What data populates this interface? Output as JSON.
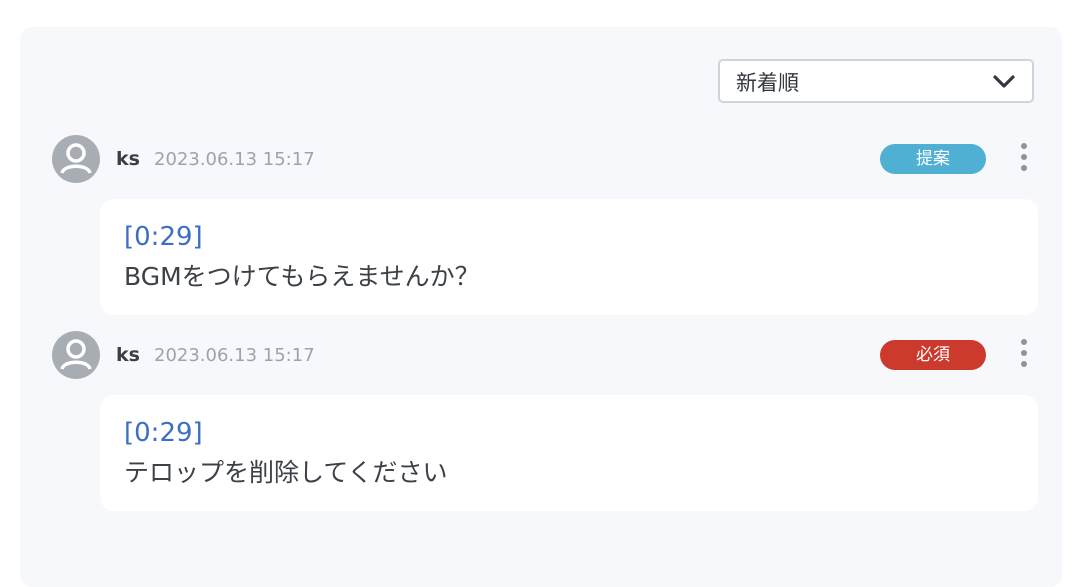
{
  "sort": {
    "selected": "新着順",
    "icon": "chevron-down-icon"
  },
  "comments": [
    {
      "author": "ks",
      "timestamp": "2023.06.13 15:17",
      "badge": "提案",
      "badge_color": "#4fb0d4",
      "timecode": "[0:29]",
      "text": "BGMをつけてもらえませんか？",
      "avatar_icon": "user-avatar-icon",
      "menu_icon": "more-vertical-icon"
    },
    {
      "author": "ks",
      "timestamp": "2023.06.13 15:17",
      "badge": "必須",
      "badge_color": "#cc3a2e",
      "timecode": "[0:29]",
      "text": "テロップを削除してください",
      "avatar_icon": "user-avatar-icon",
      "menu_icon": "more-vertical-icon"
    }
  ]
}
